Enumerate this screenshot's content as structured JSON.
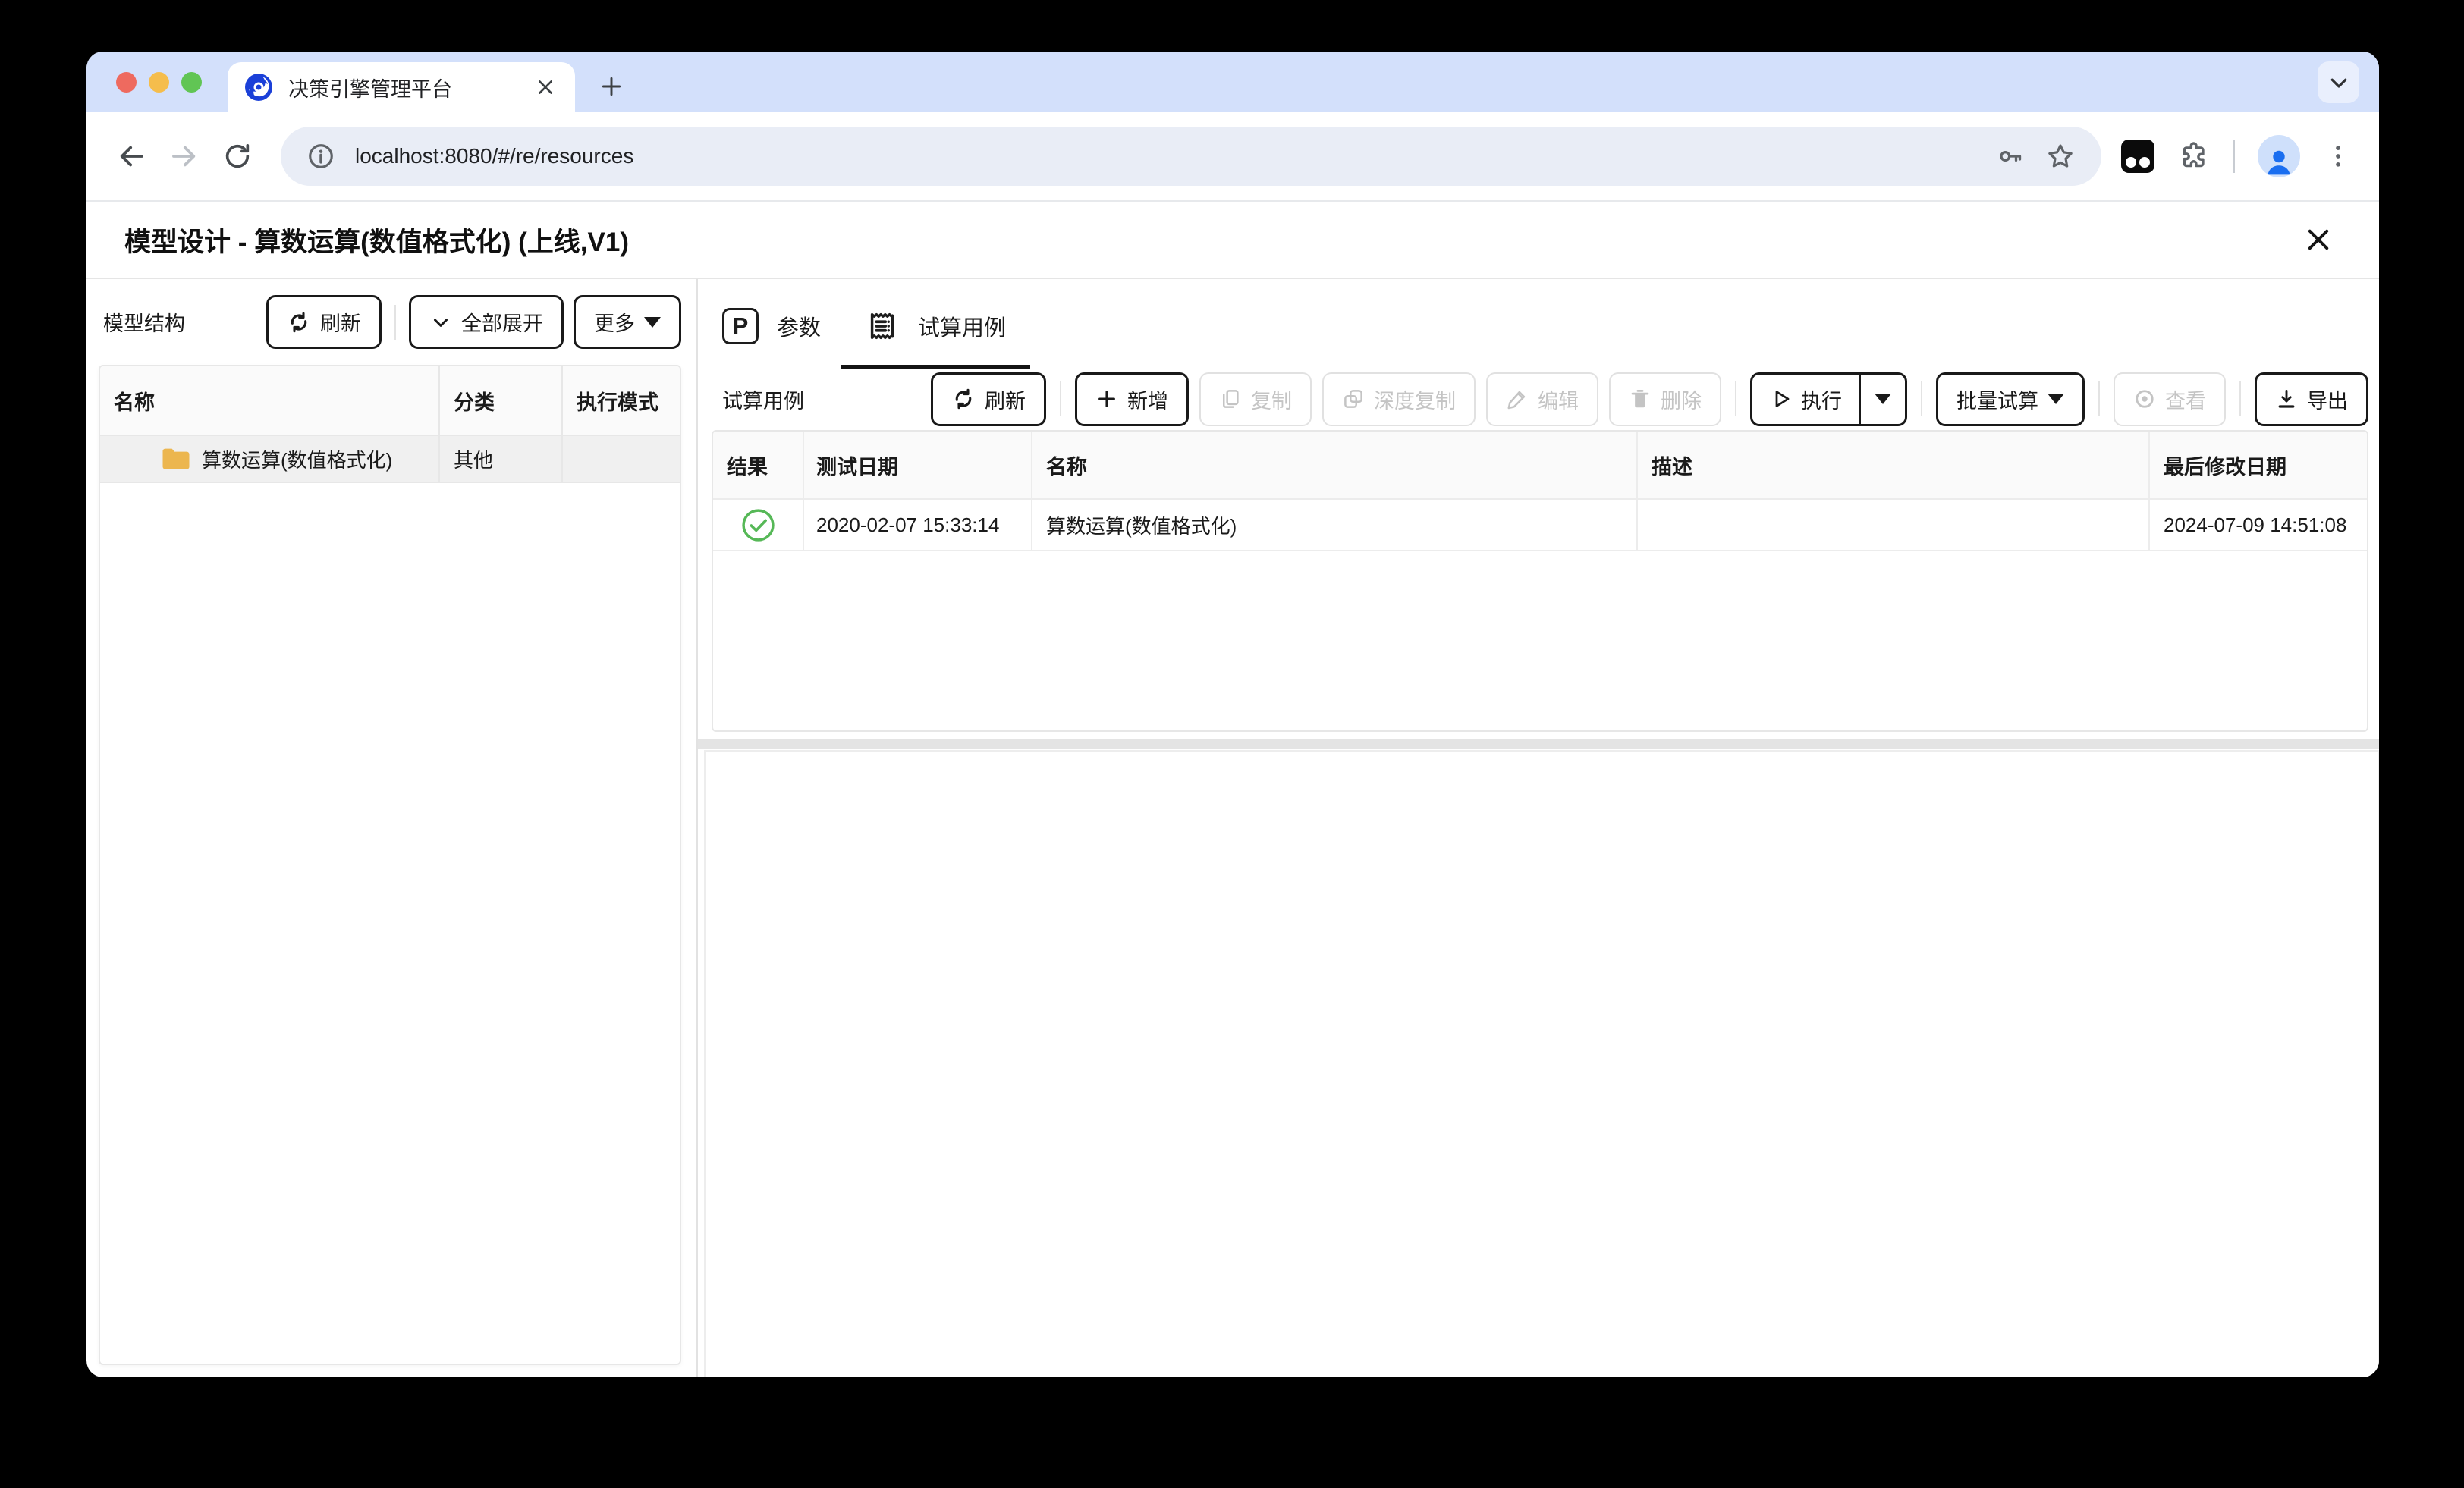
{
  "browser": {
    "tab_title": "决策引擎管理平台",
    "url": "localhost:8080/#/re/resources"
  },
  "modal": {
    "title": "模型设计 - 算数运算(数值格式化) (上线,V1)"
  },
  "left_panel": {
    "title": "模型结构",
    "refresh_label": "刷新",
    "expand_all_label": "全部展开",
    "more_label": "更多",
    "columns": [
      "名称",
      "分类",
      "执行模式"
    ],
    "rows": [
      {
        "name": "算数运算(数值格式化)",
        "category": "其他",
        "exec_mode": ""
      }
    ]
  },
  "right_panel": {
    "tab_params_icon": "P",
    "tab_params": "参数",
    "tab_cases": "试算用例",
    "section_title": "试算用例",
    "btn_refresh": "刷新",
    "btn_add": "新增",
    "btn_copy": "复制",
    "btn_deep_copy": "深度复制",
    "btn_edit": "编辑",
    "btn_delete": "删除",
    "btn_execute": "执行",
    "btn_batch": "批量试算",
    "btn_view": "查看",
    "btn_export": "导出",
    "columns": [
      "结果",
      "测试日期",
      "名称",
      "描述",
      "最后修改日期"
    ],
    "rows": [
      {
        "result": "success",
        "test_date": "2020-02-07 15:33:14",
        "name": "算数运算(数值格式化)",
        "description": "",
        "last_modified": "2024-07-09 14:51:08"
      }
    ]
  },
  "colors": {
    "tabstrip": "#d3e0fb",
    "success_green": "#56b857",
    "folder_yellow": "#ecb64f",
    "accent_blue": "#1a57e8"
  }
}
